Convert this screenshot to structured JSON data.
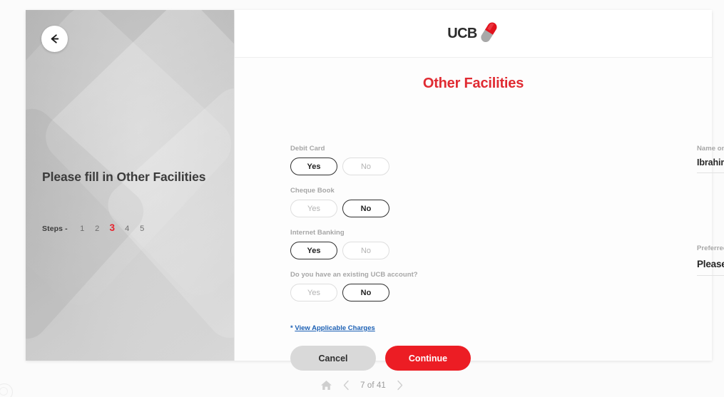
{
  "sidebar": {
    "back_icon": "arrow-left-icon",
    "heading": "Please fill in Other Facilities",
    "steps_label": "Steps -",
    "steps": [
      "1",
      "2",
      "3",
      "4",
      "5"
    ],
    "active_step": "3"
  },
  "header": {
    "logo_text": "UCB",
    "logo_icon": "ucb-capsule-logo"
  },
  "main": {
    "title": "Other Facilities",
    "questions": [
      {
        "label": "Debit Card",
        "yes": "Yes",
        "no": "No",
        "selected": "Yes"
      },
      {
        "label": "Cheque Book",
        "yes": "Yes",
        "no": "No",
        "selected": "No"
      },
      {
        "label": "Internet Banking",
        "yes": "Yes",
        "no": "No",
        "selected": "Yes"
      },
      {
        "label": "Do you have an existing UCB account?",
        "yes": "Yes",
        "no": "No",
        "selected": "No"
      }
    ],
    "name_on_card": {
      "label": "Name on Debit Card",
      "value": "Ibrahim"
    },
    "preferred_branch": {
      "label": "Preferred Branch",
      "value": "Please select",
      "icon": "chevron-down-icon"
    },
    "charges_link": {
      "star": "* ",
      "text": "View Applicable Charges"
    },
    "cancel_label": "Cancel",
    "continue_label": "Continue"
  },
  "footer": {
    "home_icon": "home-icon",
    "prev_icon": "chevron-left-icon",
    "next_icon": "chevron-right-icon",
    "page_indicator": "7 of 41"
  },
  "colors": {
    "brand_red": "#ec1d24",
    "title_red": "#e02b32",
    "link_blue": "#1a5fb4",
    "cancel_gray": "#d9d9d9"
  }
}
